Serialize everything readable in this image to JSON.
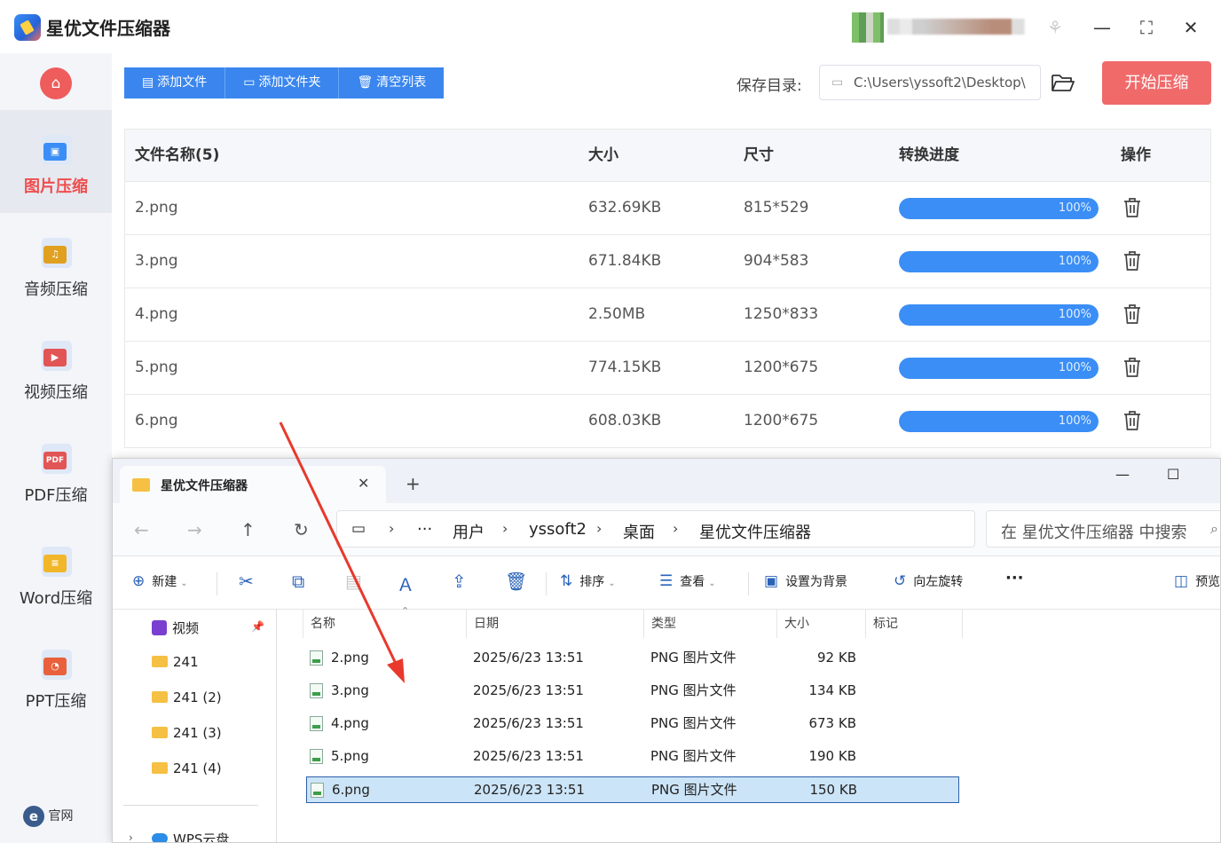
{
  "app": {
    "title": "星优文件压缩器",
    "window_controls": {
      "skin": "⚘",
      "minimize": "—",
      "maximize": "⛶",
      "close": "✕"
    }
  },
  "sidebar": {
    "items": [
      {
        "label": "图片压缩",
        "icon": "image-icon",
        "color": "#3a8ef6",
        "active": true
      },
      {
        "label": "音频压缩",
        "icon": "music-icon",
        "color": "#e0a020",
        "active": false
      },
      {
        "label": "视频压缩",
        "icon": "video-icon",
        "color": "#e25555",
        "active": false
      },
      {
        "label": "PDF压缩",
        "icon": "pdf-icon",
        "color": "#e25555",
        "active": false
      },
      {
        "label": "Word压缩",
        "icon": "word-icon",
        "color": "#f2b62a",
        "active": false
      },
      {
        "label": "PPT压缩",
        "icon": "ppt-icon",
        "color": "#e8603c",
        "active": false
      }
    ],
    "official_label": "官网"
  },
  "toolbar": {
    "add_file": "添加文件",
    "add_folder": "添加文件夹",
    "clear_list": "清空列表",
    "save_dir_label": "保存目录:",
    "save_dir_value": "C:\\Users\\yssoft2\\Desktop\\",
    "start_button": "开始压缩"
  },
  "table": {
    "headers": {
      "name": "文件名称(5)",
      "size": "大小",
      "dimensions": "尺寸",
      "progress": "转换进度",
      "actions": "操作"
    },
    "rows": [
      {
        "name": "2.png",
        "size": "632.69KB",
        "dimensions": "815*529",
        "progress": 100,
        "progress_label": "100%"
      },
      {
        "name": "3.png",
        "size": "671.84KB",
        "dimensions": "904*583",
        "progress": 100,
        "progress_label": "100%"
      },
      {
        "name": "4.png",
        "size": "2.50MB",
        "dimensions": "1250*833",
        "progress": 100,
        "progress_label": "100%"
      },
      {
        "name": "5.png",
        "size": "774.15KB",
        "dimensions": "1200*675",
        "progress": 100,
        "progress_label": "100%"
      },
      {
        "name": "6.png",
        "size": "608.03KB",
        "dimensions": "1200*675",
        "progress": 100,
        "progress_label": "100%"
      }
    ]
  },
  "explorer": {
    "tab_title": "星优文件压缩器",
    "new_tab": "+",
    "breadcrumb": [
      "用户",
      "yssoft2",
      "桌面",
      "星优文件压缩器"
    ],
    "breadcrumb_more": "···",
    "search_placeholder": "在 星优文件压缩器 中搜索",
    "commands": {
      "new": "新建",
      "sort": "排序",
      "view": "查看",
      "set_background": "设置为背景",
      "rotate_left": "向左旋转",
      "more": "···",
      "preview": "预览"
    },
    "nav": {
      "items": [
        "视频",
        "241",
        "241 (2)",
        "241 (3)",
        "241 (4)"
      ],
      "cloud": "WPS云盘"
    },
    "columns": {
      "name": "名称",
      "date": "日期",
      "type": "类型",
      "size": "大小",
      "tags": "标记"
    },
    "files": [
      {
        "name": "2.png",
        "date": "2025/6/23 13:51",
        "type": "PNG 图片文件",
        "size": "92 KB",
        "selected": false
      },
      {
        "name": "3.png",
        "date": "2025/6/23 13:51",
        "type": "PNG 图片文件",
        "size": "134 KB",
        "selected": false
      },
      {
        "name": "4.png",
        "date": "2025/6/23 13:51",
        "type": "PNG 图片文件",
        "size": "673 KB",
        "selected": false
      },
      {
        "name": "5.png",
        "date": "2025/6/23 13:51",
        "type": "PNG 图片文件",
        "size": "190 KB",
        "selected": false
      },
      {
        "name": "6.png",
        "date": "2025/6/23 13:51",
        "type": "PNG 图片文件",
        "size": "150 KB",
        "selected": true
      }
    ]
  },
  "colors": {
    "accent": "#3a86ee",
    "start_button": "#f06a6a",
    "active_nav": "#ef4e4e",
    "arrow": "#e8392c",
    "selection": "#cce4f7"
  }
}
